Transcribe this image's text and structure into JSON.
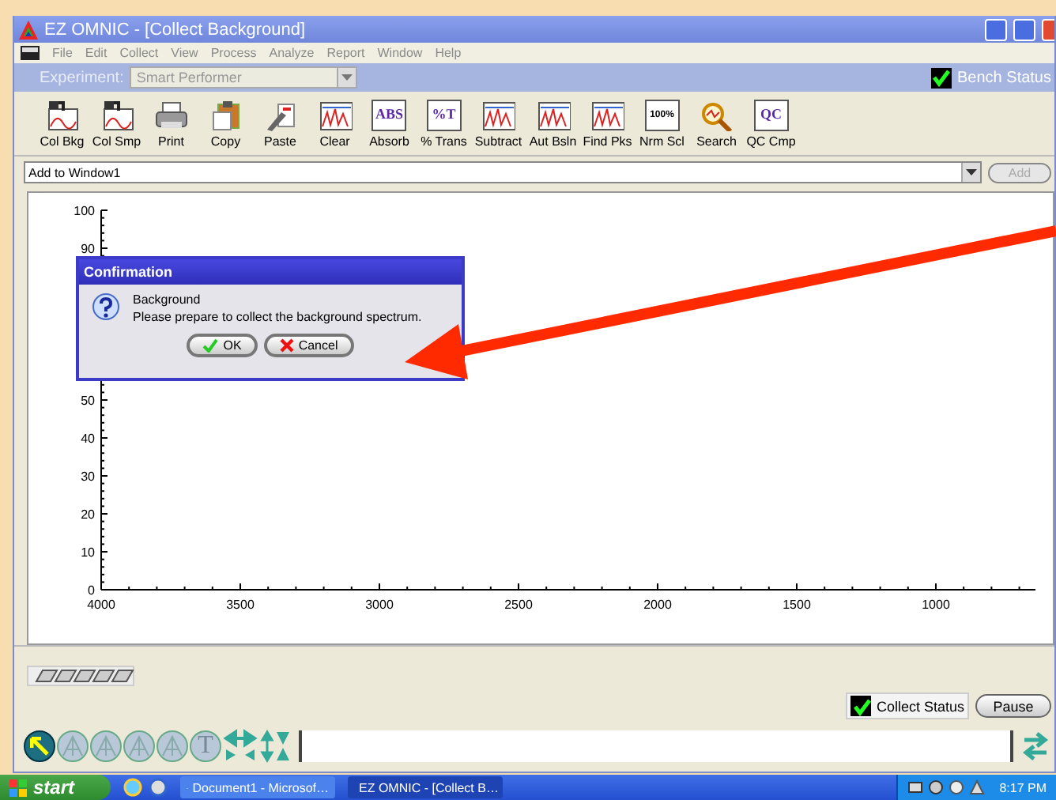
{
  "window": {
    "title": "EZ OMNIC - [Collect Background]"
  },
  "menu": [
    "File",
    "Edit",
    "Collect",
    "View",
    "Process",
    "Analyze",
    "Report",
    "Window",
    "Help"
  ],
  "experiment": {
    "label": "Experiment:",
    "value": "Smart Performer",
    "disabled": true
  },
  "bench_status": {
    "label": "Bench Status",
    "checked": true
  },
  "toolbar": [
    {
      "label": "Col Bkg",
      "kind": "collect"
    },
    {
      "label": "Col Smp",
      "kind": "collect"
    },
    {
      "label": "Print",
      "kind": "printer"
    },
    {
      "label": "Copy",
      "kind": "clipboard"
    },
    {
      "label": "Paste",
      "kind": "paste"
    },
    {
      "label": "Clear",
      "kind": "spectrum"
    },
    {
      "label": "Absorb",
      "kind": "text",
      "icon_text": "ABS"
    },
    {
      "label": "% Trans",
      "kind": "text",
      "icon_text": "%T"
    },
    {
      "label": "Subtract",
      "kind": "spectrum"
    },
    {
      "label": "Aut Bsln",
      "kind": "spectrum"
    },
    {
      "label": "Find Pks",
      "kind": "spectrum"
    },
    {
      "label": "Nrm Scl",
      "kind": "text",
      "icon_text": "100%"
    },
    {
      "label": "Search",
      "kind": "magnifier"
    },
    {
      "label": "QC Cmp",
      "kind": "text",
      "icon_text": "QC"
    }
  ],
  "add_bar": {
    "value": "Add to Window1",
    "button": "Add",
    "button_disabled": true
  },
  "chart_data": {
    "type": "line",
    "xlim": [
      4000,
      642
    ],
    "ylim": [
      0,
      100
    ],
    "xticks": [
      4000,
      3500,
      3000,
      2500,
      2000,
      1500,
      1000
    ],
    "yticks": [
      0,
      10,
      20,
      30,
      40,
      50,
      90,
      100
    ]
  },
  "collect_status": {
    "label": "Collect Status",
    "checked": true
  },
  "pause_button": "Pause",
  "bottom_tools": [
    {
      "kind": "arrow",
      "selected": true
    },
    {
      "kind": "peak",
      "selected": false
    },
    {
      "kind": "peak",
      "selected": false
    },
    {
      "kind": "peak",
      "selected": false
    },
    {
      "kind": "peak",
      "selected": false
    },
    {
      "kind": "text",
      "label": "T",
      "selected": false
    }
  ],
  "dialog": {
    "title": "Confirmation",
    "heading": "Background",
    "message": "Please prepare to collect the background spectrum.",
    "buttons": [
      {
        "label": "OK",
        "kind": "ok"
      },
      {
        "label": "Cancel",
        "kind": "cancel"
      }
    ]
  },
  "taskbar": {
    "start": "start",
    "tasks": [
      {
        "label": "Document1 - Microsof…",
        "selected": false
      },
      {
        "label": "EZ OMNIC - [Collect B…",
        "selected": true
      }
    ],
    "clock": "8:17 PM"
  }
}
